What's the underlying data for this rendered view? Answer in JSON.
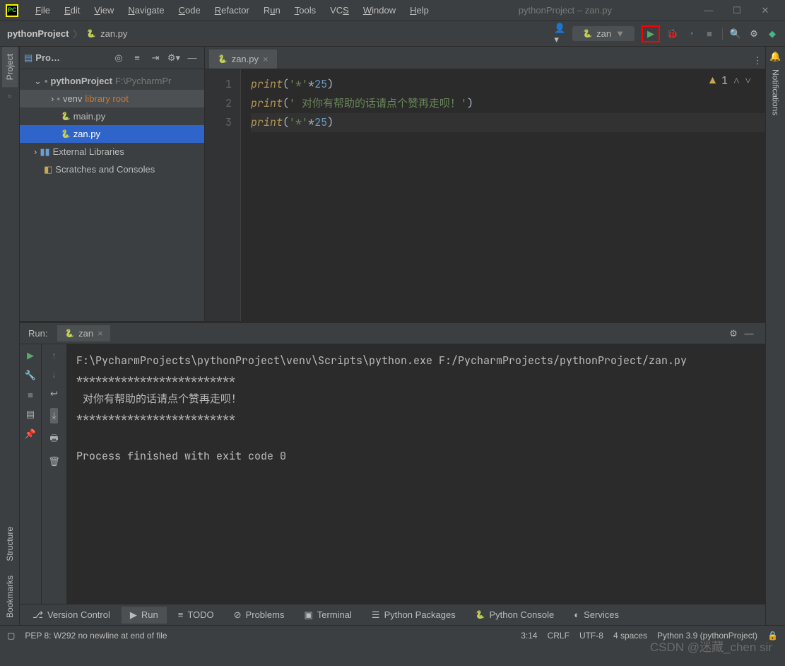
{
  "window": {
    "title": "pythonProject – zan.py",
    "menus": [
      "File",
      "Edit",
      "View",
      "Navigate",
      "Code",
      "Refactor",
      "Run",
      "Tools",
      "VCS",
      "Window",
      "Help"
    ]
  },
  "breadcrumb": {
    "project": "pythonProject",
    "file": "zan.py"
  },
  "runConfig": {
    "name": "zan"
  },
  "projectPanel": {
    "title": "Pro…",
    "root": "pythonProject",
    "rootPath": "F:\\PycharmPr",
    "venv": "venv",
    "venvNote": "library root",
    "files": [
      "main.py",
      "zan.py"
    ],
    "external": "External Libraries",
    "scratches": "Scratches and Consoles"
  },
  "editor": {
    "tab": "zan.py",
    "lines": [
      {
        "n": "1",
        "tokens": [
          {
            "t": "print",
            "c": "fn"
          },
          {
            "t": "(",
            "c": "plain"
          },
          {
            "t": "'*'",
            "c": "str"
          },
          {
            "t": "*",
            "c": "op"
          },
          {
            "t": "25",
            "c": "num"
          },
          {
            "t": ")",
            "c": "plain"
          }
        ]
      },
      {
        "n": "2",
        "tokens": [
          {
            "t": "print",
            "c": "fn"
          },
          {
            "t": "(",
            "c": "plain"
          },
          {
            "t": "' 对你有帮助的话请点个赞再走呗！'",
            "c": "str"
          },
          {
            "t": ")",
            "c": "plain"
          }
        ]
      },
      {
        "n": "3",
        "tokens": [
          {
            "t": "print",
            "c": "fn"
          },
          {
            "t": "(",
            "c": "plain"
          },
          {
            "t": "'*'",
            "c": "str"
          },
          {
            "t": "*",
            "c": "op"
          },
          {
            "t": "25",
            "c": "num"
          },
          {
            "t": ")",
            "c": "plain"
          }
        ]
      }
    ],
    "warnings": "1"
  },
  "runPanel": {
    "label": "Run:",
    "tab": "zan",
    "output": "F:\\PycharmProjects\\pythonProject\\venv\\Scripts\\python.exe F:/PycharmProjects/pythonProject/zan.py\n*************************\n 对你有帮助的话请点个赞再走呗！ \n*************************\n\nProcess finished with exit code 0"
  },
  "leftTabs": {
    "project": "Project",
    "structure": "Structure",
    "bookmarks": "Bookmarks"
  },
  "rightTabs": {
    "notifications": "Notifications"
  },
  "bottomTabs": {
    "vcs": "Version Control",
    "run": "Run",
    "todo": "TODO",
    "problems": "Problems",
    "terminal": "Terminal",
    "pkg": "Python Packages",
    "pycon": "Python Console",
    "services": "Services"
  },
  "statusBar": {
    "msg": "PEP 8: W292 no newline at end of file",
    "pos": "3:14",
    "eol": "CRLF",
    "enc": "UTF-8",
    "indent": "4 spaces",
    "interp": "Python 3.9 (pythonProject)"
  },
  "watermark": "CSDN @迷藏_chen sir"
}
